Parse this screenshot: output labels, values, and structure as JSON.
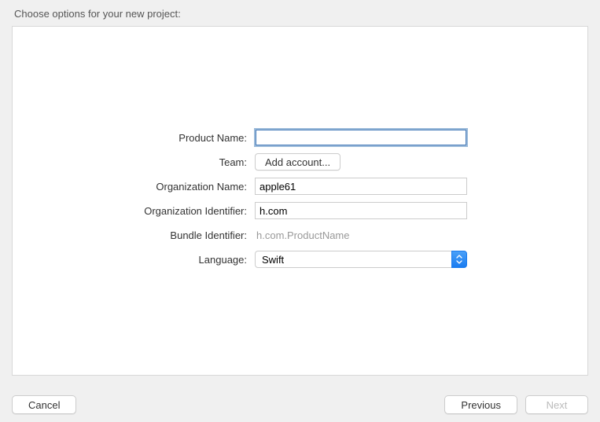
{
  "title": "Choose options for your new project:",
  "form": {
    "product_name": {
      "label": "Product Name:",
      "value": ""
    },
    "team": {
      "label": "Team:",
      "button": "Add account..."
    },
    "org_name": {
      "label": "Organization Name:",
      "value": "apple61"
    },
    "org_id": {
      "label": "Organization Identifier:",
      "value": "h.com"
    },
    "bundle_id": {
      "label": "Bundle Identifier:",
      "value": "h.com.ProductName"
    },
    "language": {
      "label": "Language:",
      "value": "Swift"
    }
  },
  "footer": {
    "cancel": "Cancel",
    "previous": "Previous",
    "next": "Next"
  }
}
